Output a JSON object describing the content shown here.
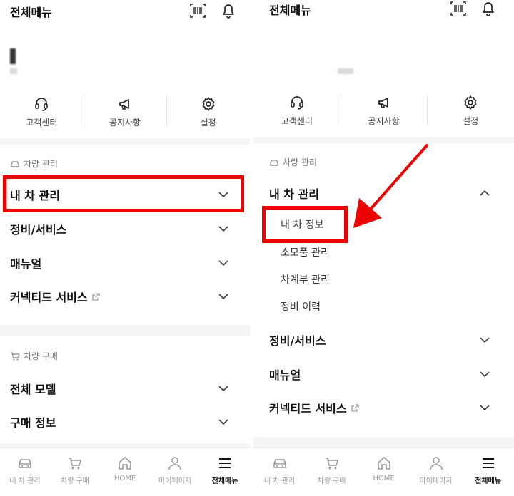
{
  "header": {
    "title": "전체메뉴"
  },
  "quick_menu": [
    {
      "label": "고객센터",
      "icon": "headset-icon"
    },
    {
      "label": "공지사항",
      "icon": "megaphone-icon"
    },
    {
      "label": "설정",
      "icon": "gear-icon"
    }
  ],
  "left": {
    "car_section": {
      "title": "차량 관리",
      "items": [
        "내 차 관리",
        "정비/서비스",
        "매뉴얼",
        "커넥티드 서비스"
      ]
    },
    "purchase_section": {
      "title": "차량 구매",
      "items": [
        "전체 모델",
        "구매 정보"
      ]
    }
  },
  "right": {
    "car_section": {
      "title": "차량 관리",
      "expanded_item": "내 차 관리",
      "sub_items": [
        "내 차 정보",
        "소모품 관리",
        "차계부 관리",
        "정비 이력"
      ],
      "items": [
        "정비/서비스",
        "매뉴얼",
        "커넥티드 서비스"
      ]
    }
  },
  "tabbar": [
    {
      "label": "내 차 관리",
      "icon": "car-icon",
      "active": false
    },
    {
      "label": "차량 구매",
      "icon": "cart-icon",
      "active": false
    },
    {
      "label": "HOME",
      "icon": "home-icon",
      "active": false
    },
    {
      "label": "마이페이지",
      "icon": "person-icon",
      "active": false
    },
    {
      "label": "전체메뉴",
      "icon": "hamburger-icon",
      "active": true
    }
  ],
  "colors": {
    "highlight": "#ee0000",
    "panel_bg": "#f5f5f5",
    "active_tab": "#111111",
    "inactive_tab": "#999999"
  }
}
